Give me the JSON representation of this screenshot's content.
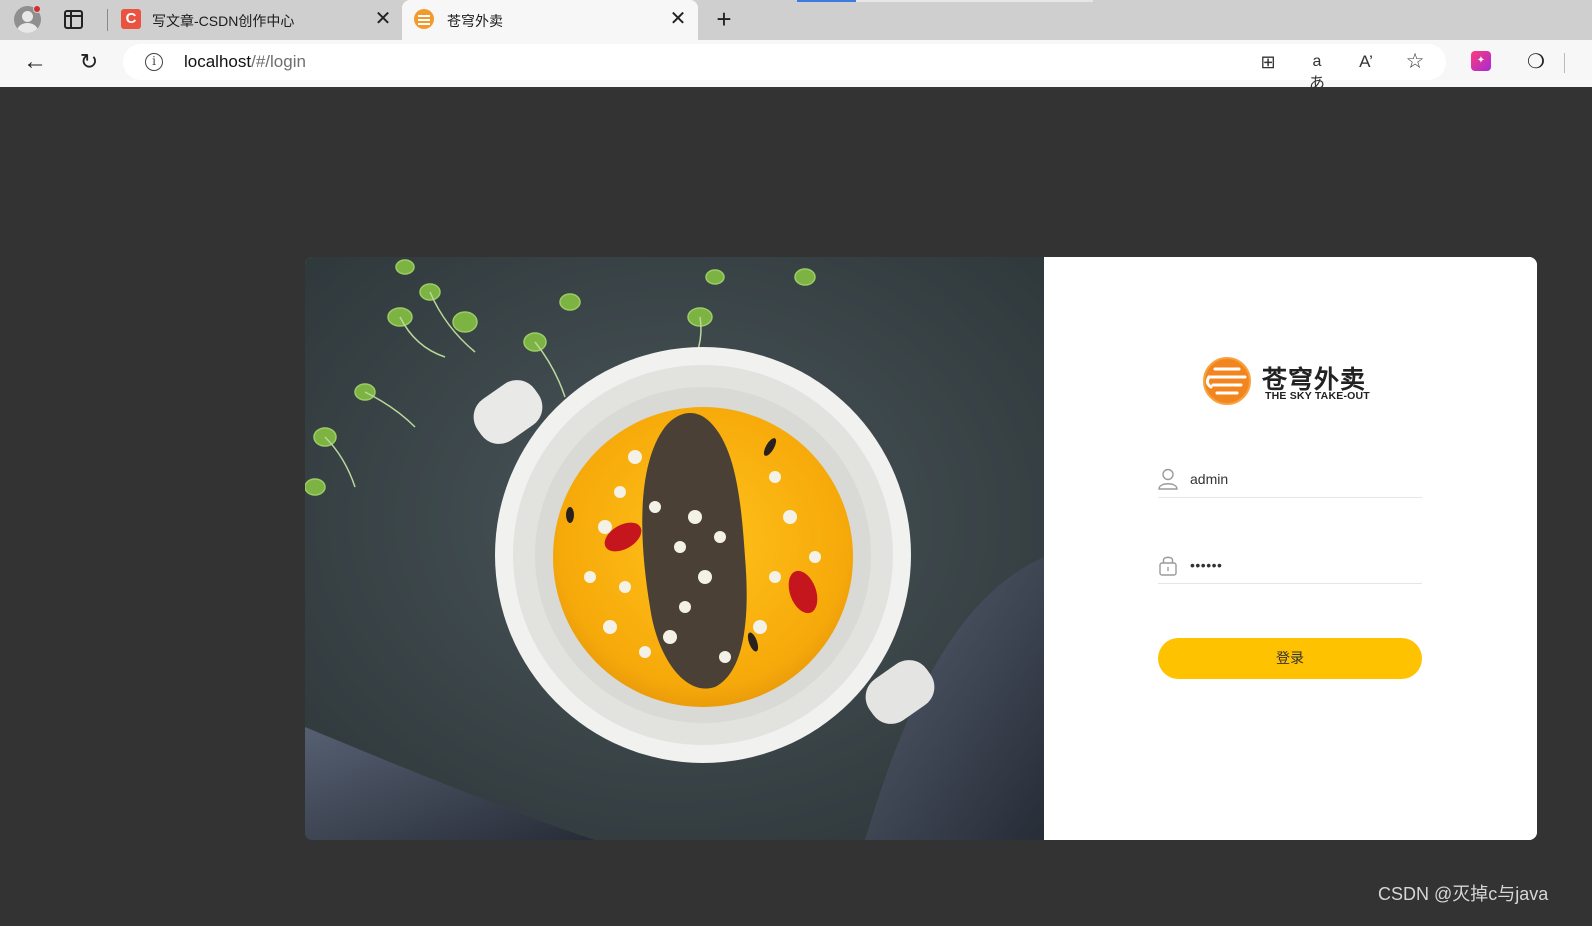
{
  "browser": {
    "tabs": [
      {
        "title": "写文章-CSDN创作中心",
        "favicon": "C",
        "active": false
      },
      {
        "title": "苍穹外卖",
        "favicon": "sky-takeout-icon",
        "active": true
      }
    ],
    "new_tab_label": "+",
    "close_glyph": "✕",
    "address": {
      "host": "localhost",
      "path": "/#/login"
    },
    "ext_badge_label": "✦"
  },
  "login": {
    "brand": {
      "name_cn": "苍穹外卖",
      "name_en": "THE SKY TAKE-OUT"
    },
    "username": "admin",
    "password_mask": "••••••",
    "submit_label": "登录"
  },
  "watermark": "CSDN @灭掉c与java",
  "colors": {
    "accent": "#ffc200",
    "page_bg": "#333333",
    "logo_orange": "#f3851f"
  }
}
